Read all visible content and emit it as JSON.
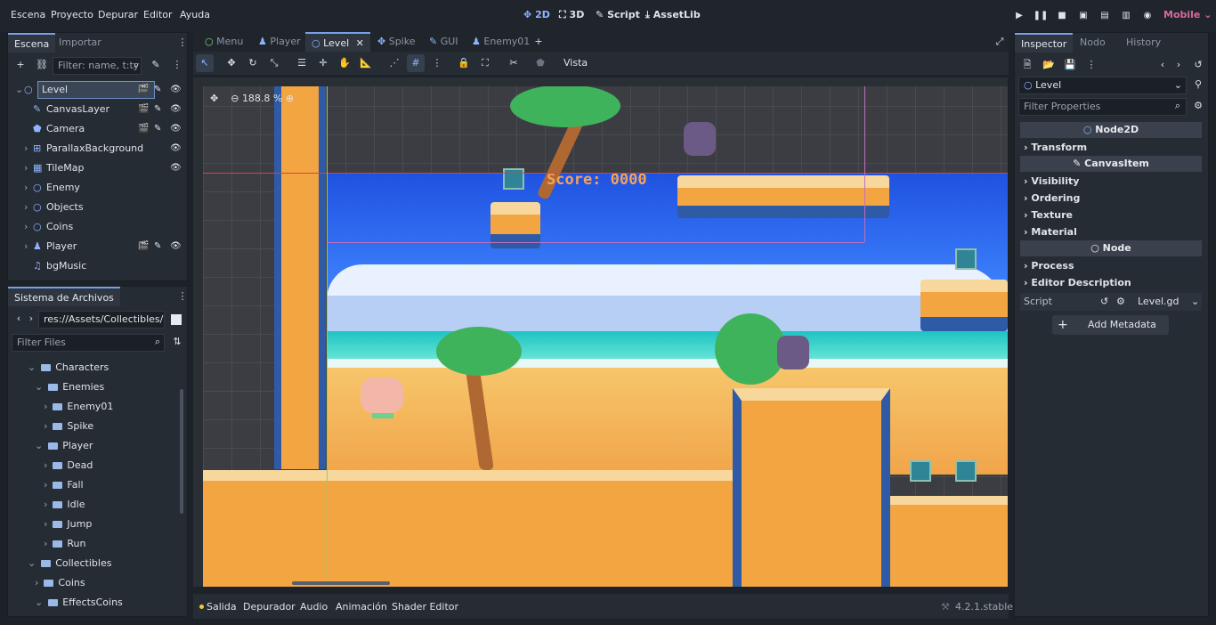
{
  "menu": [
    "Escena",
    "Proyecto",
    "Depurar",
    "Editor",
    "Ayuda"
  ],
  "workspaces": [
    {
      "label": "2D",
      "active": true
    },
    {
      "label": "3D"
    },
    {
      "label": "Script"
    },
    {
      "label": "AssetLib"
    }
  ],
  "renderer": "Mobile",
  "scene_dock": {
    "tabs": [
      "Escena",
      "Importar"
    ],
    "filter_placeholder": "Filter: name, t:ty",
    "nodes": [
      {
        "label": "Level",
        "type": "Node2D",
        "selected": true
      },
      {
        "label": "CanvasLayer"
      },
      {
        "label": "Camera"
      },
      {
        "label": "ParallaxBackground"
      },
      {
        "label": "TileMap"
      },
      {
        "label": "Enemy"
      },
      {
        "label": "Objects"
      },
      {
        "label": "Coins"
      },
      {
        "label": "Player"
      },
      {
        "label": "bgMusic"
      }
    ]
  },
  "filesystem": {
    "title": "Sistema de Archivos",
    "path": "res://Assets/Collectibles/Effe",
    "filter_placeholder": "Filter Files",
    "items": [
      "Characters",
      "Enemies",
      "Enemy01",
      "Spike",
      "Player",
      "Dead",
      "Fall",
      "Idle",
      "Jump",
      "Run",
      "Collectibles",
      "Coins",
      "EffectsCoins"
    ]
  },
  "scene_tabs": [
    "Menu",
    "Player",
    "Level",
    "Spike",
    "GUI",
    "Enemy01"
  ],
  "toolbar": {
    "view_label": "Vista",
    "zoom": "188.8 %"
  },
  "game": {
    "score_label": "Score: 0000"
  },
  "inspector": {
    "tabs": [
      "Inspector",
      "Nodo",
      "History"
    ],
    "node_name": "Level",
    "filter_placeholder": "Filter Properties",
    "sections": [
      "Node2D",
      "Transform",
      "CanvasItem",
      "Visibility",
      "Ordering",
      "Texture",
      "Material",
      "Node",
      "Process",
      "Editor Description"
    ],
    "script_label": "Script",
    "script_value": "Level.gd",
    "add_metadata": "Add Metadata"
  },
  "bottom_panel": {
    "tabs": [
      "Salida",
      "Depurador",
      "Audio",
      "Animación",
      "Shader Editor"
    ],
    "version": "4.2.1.stable"
  },
  "colors": {
    "accent": "#76a0e8",
    "bg": "#1d2229",
    "panel": "#262c34"
  }
}
